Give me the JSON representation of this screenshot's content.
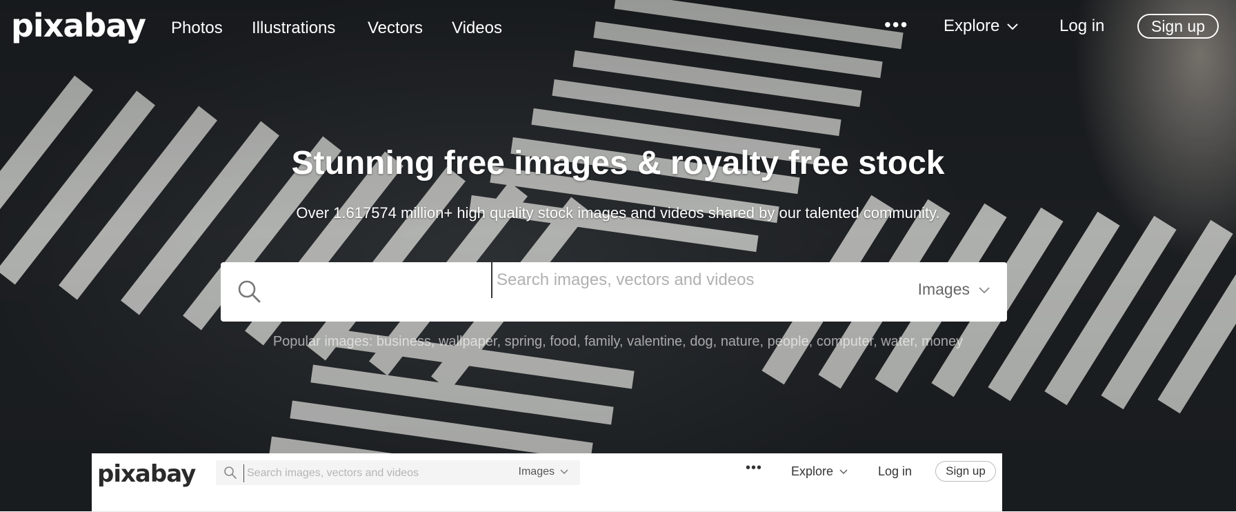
{
  "brand": {
    "logo_text": "pixabay"
  },
  "nav": {
    "links": [
      "Photos",
      "Illustrations",
      "Vectors",
      "Videos"
    ],
    "more_label": "•••",
    "explore_label": "Explore",
    "login_label": "Log in",
    "signup_label": "Sign up"
  },
  "hero": {
    "headline": "Stunning free images & royalty free stock",
    "subheadline": "Over 1.617574 million+ high quality stock images and videos shared by our talented community."
  },
  "search": {
    "placeholder": "Search images, vectors and videos",
    "type_selected": "Images",
    "popular_label": "Popular images:",
    "popular_terms": [
      "business",
      "wallpaper",
      "spring",
      "food",
      "family",
      "valentine",
      "dog",
      "nature",
      "people",
      "computer",
      "water",
      "money"
    ]
  },
  "sticky_header": {
    "logo_text": "pixabay",
    "search_placeholder": "Search images, vectors and videos",
    "type_selected": "Images",
    "more_label": "•••",
    "explore_label": "Explore",
    "login_label": "Log in",
    "signup_label": "Sign up"
  },
  "icons": {
    "search": "search-icon",
    "chevron": "chevron-down-icon"
  },
  "colors": {
    "hero_dark": "#1d2023",
    "stripe": "#cfd0cc",
    "text_light": "#ffffff",
    "mini_header_bg": "#ffffff"
  }
}
